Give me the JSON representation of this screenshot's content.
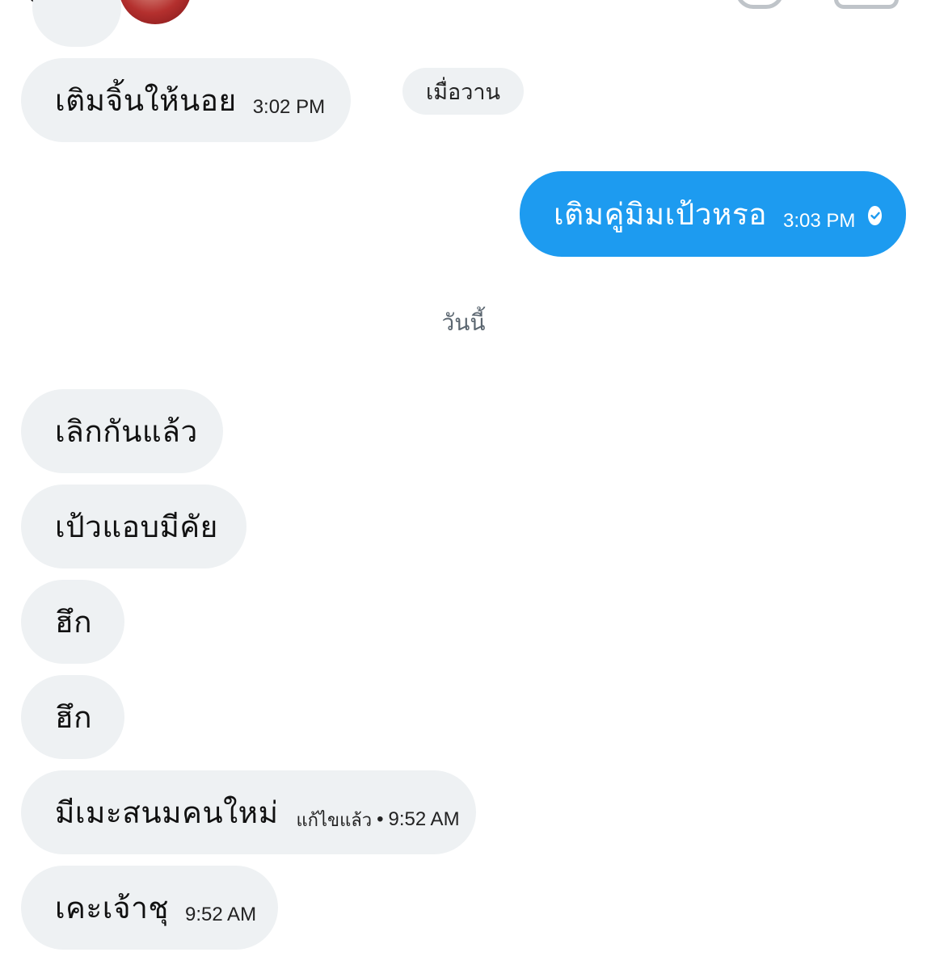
{
  "header": {
    "back_icon": "back-arrow-icon",
    "avatar_icon": "avatar",
    "call_icon": "phone-icon",
    "video_icon": "video-call-icon"
  },
  "date_separators": {
    "yesterday": "เมื่อวาน",
    "today": "วันนี้"
  },
  "messages": [
    {
      "direction": "incoming",
      "text": "เติมจิ้นให้นอย",
      "time": "3:02 PM"
    },
    {
      "direction": "outgoing",
      "text": "เติมคู่มิมเป้วหรอ",
      "time": "3:03 PM",
      "status_icon": "read-check-icon"
    },
    {
      "direction": "incoming",
      "text": "เลิกกันแล้ว"
    },
    {
      "direction": "incoming",
      "text": "เป้วแอบมีคัย"
    },
    {
      "direction": "incoming",
      "text": "ฮึก"
    },
    {
      "direction": "incoming",
      "text": "ฮึก"
    },
    {
      "direction": "incoming",
      "text": "มีเมะสนมคนใหม่",
      "edited": "แก้ไขแล้ว",
      "separator": "•",
      "time": "9:52 AM"
    },
    {
      "direction": "incoming",
      "text": "เคะเจ้าชุ",
      "time": "9:52 AM"
    }
  ],
  "colors": {
    "incoming_bubble": "#eef1f3",
    "outgoing_bubble": "#1d9bf0",
    "date_text": "#5b6670"
  }
}
